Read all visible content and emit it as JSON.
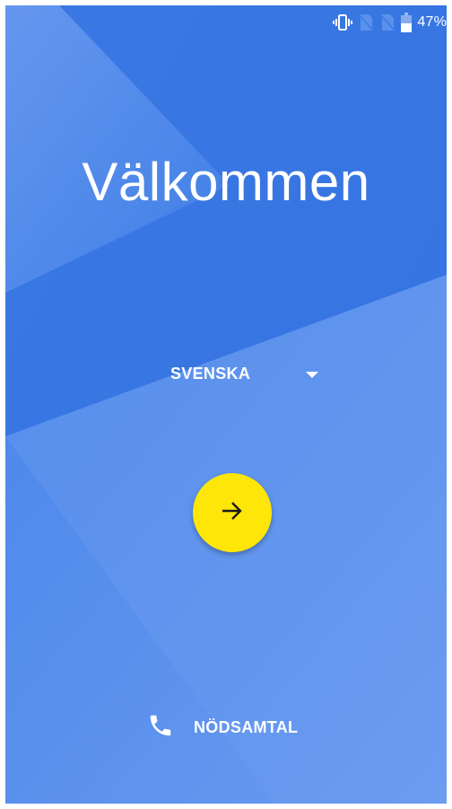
{
  "status_bar": {
    "battery_percent": "47%",
    "icons": [
      "vibrate-icon",
      "no-sim-icon",
      "no-sim-icon",
      "battery-icon"
    ]
  },
  "welcome": {
    "title": "Välkommen"
  },
  "language": {
    "selected": "SVENSKA",
    "icon": "dropdown-arrow-icon"
  },
  "next_button": {
    "icon": "arrow-right-icon",
    "color": "#fde608"
  },
  "emergency": {
    "label": "NÖDSAMTAL",
    "icon": "phone-icon"
  },
  "colors": {
    "background": "#3f7fe6",
    "accent": "#fde608",
    "text": "#ffffff"
  }
}
